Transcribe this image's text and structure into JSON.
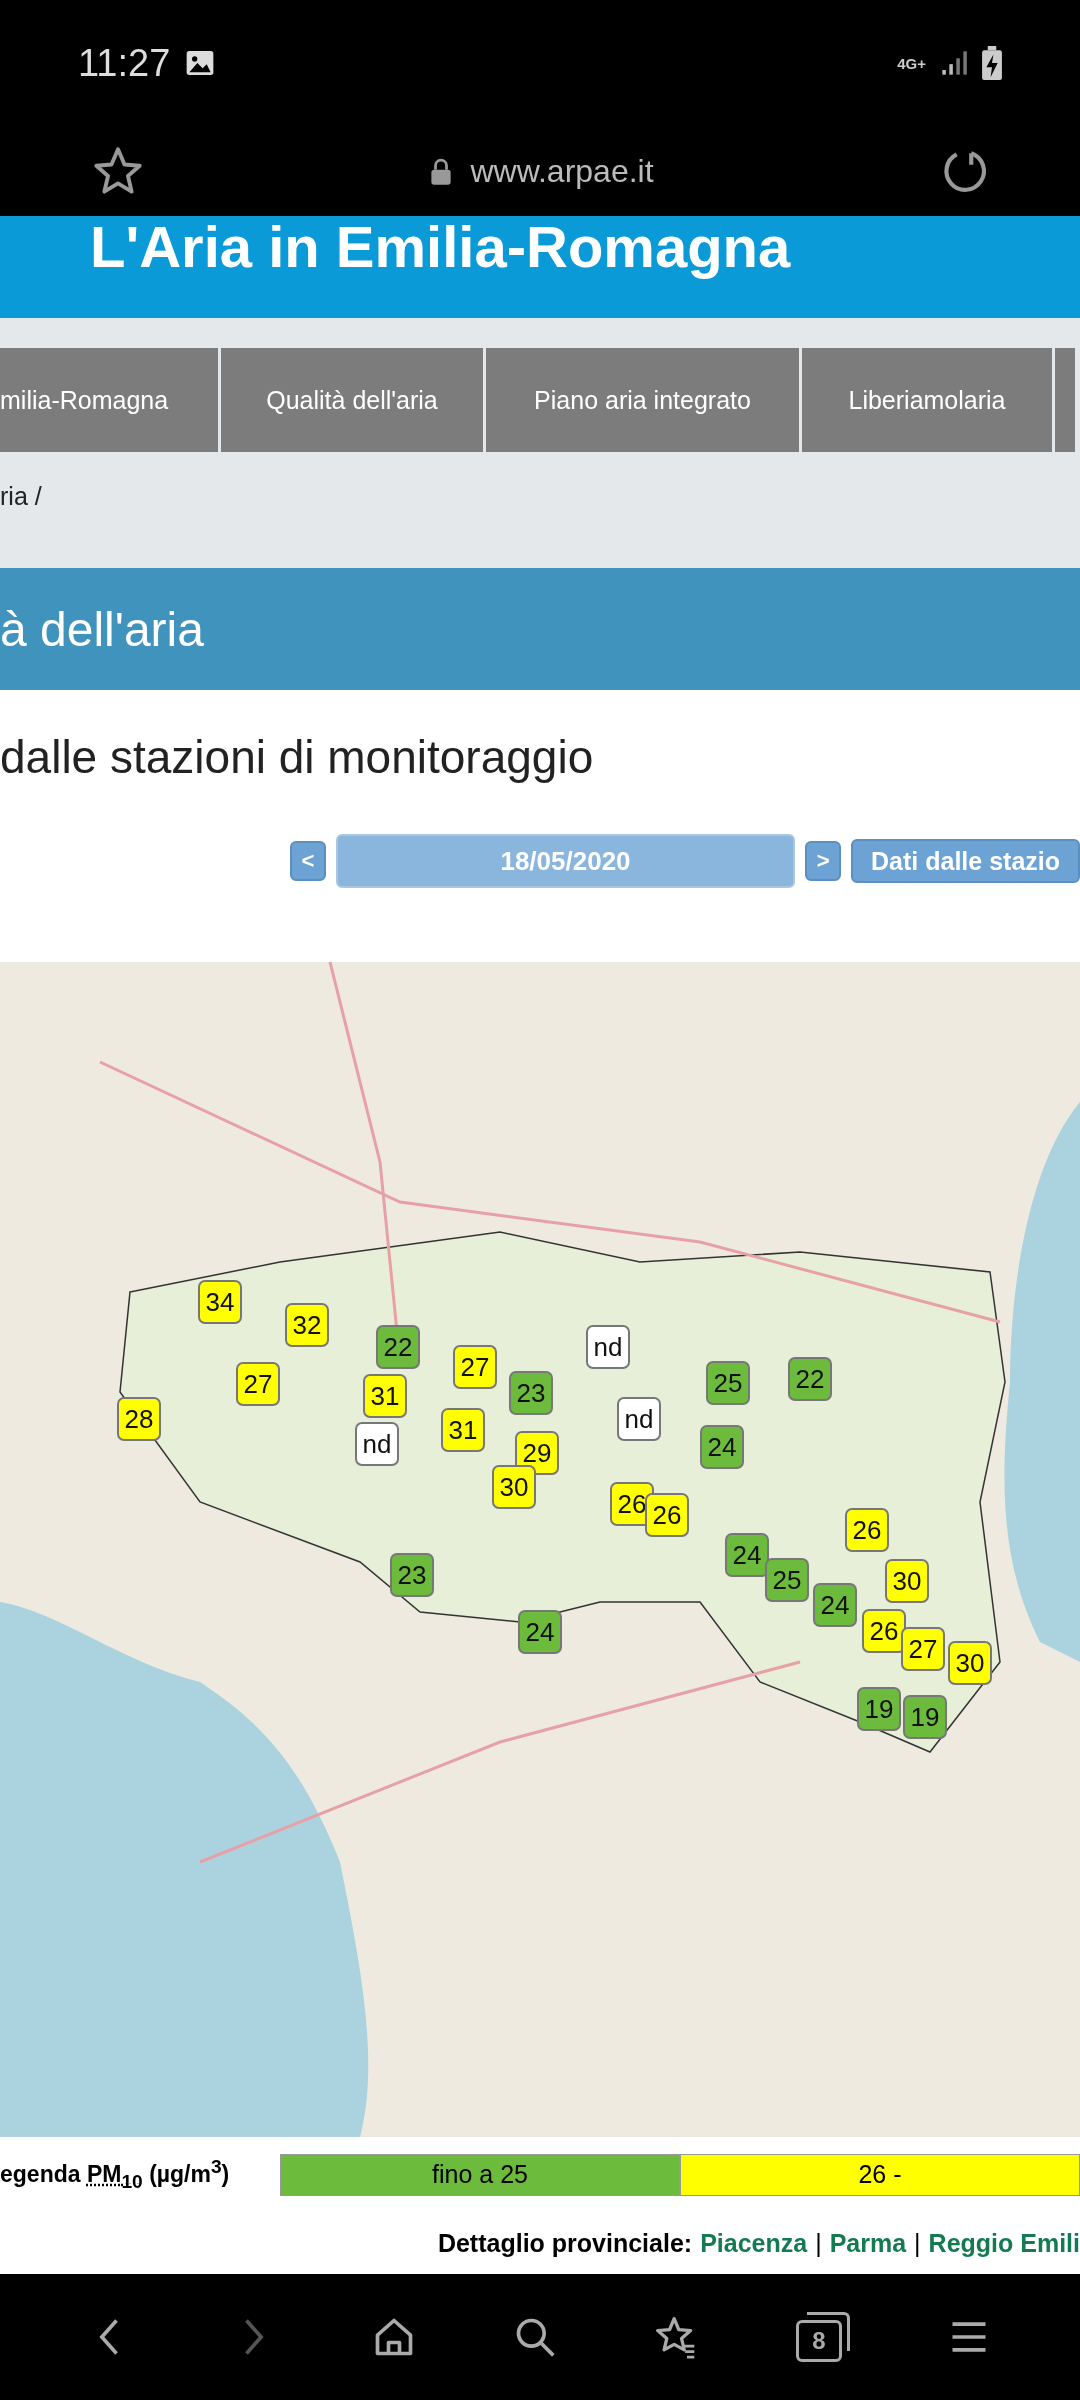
{
  "status_bar": {
    "time": "11:27",
    "network": "4G+"
  },
  "browser": {
    "url": "www.arpae.it",
    "tab_count": "8"
  },
  "banner": {
    "title": "L'Aria in Emilia-Romagna"
  },
  "nav": {
    "items": [
      "milia-Romagna",
      "Qualità dell'aria",
      "Piano aria integrato",
      "Liberiamolaria"
    ]
  },
  "breadcrumb": "ria /",
  "page_title": "à dell'aria",
  "section_title": "dalle stazioni di monitoraggio",
  "date_nav": {
    "prev": "<",
    "date": "18/05/2020",
    "next": ">",
    "stations_button": "Dati dalle stazio"
  },
  "map": {
    "markers": [
      {
        "value": "34",
        "color": "#ffff00"
      },
      {
        "value": "32",
        "color": "#ffff00"
      },
      {
        "value": "22",
        "color": "#6dbb3c"
      },
      {
        "value": "27",
        "color": "#ffff00"
      },
      {
        "value": "nd",
        "color": "#ffffff"
      },
      {
        "value": "27",
        "color": "#ffff00"
      },
      {
        "value": "31",
        "color": "#ffff00"
      },
      {
        "value": "23",
        "color": "#6dbb3c"
      },
      {
        "value": "25",
        "color": "#6dbb3c"
      },
      {
        "value": "22",
        "color": "#6dbb3c"
      },
      {
        "value": "28",
        "color": "#ffff00"
      },
      {
        "value": "31",
        "color": "#ffff00"
      },
      {
        "value": "nd",
        "color": "#ffffff"
      },
      {
        "value": "nd",
        "color": "#ffffff"
      },
      {
        "value": "29",
        "color": "#ffff00"
      },
      {
        "value": "24",
        "color": "#6dbb3c"
      },
      {
        "value": "30",
        "color": "#ffff00"
      },
      {
        "value": "26",
        "color": "#ffff00"
      },
      {
        "value": "26",
        "color": "#ffff00"
      },
      {
        "value": "26",
        "color": "#ffff00"
      },
      {
        "value": "24",
        "color": "#6dbb3c"
      },
      {
        "value": "23",
        "color": "#6dbb3c"
      },
      {
        "value": "25",
        "color": "#6dbb3c"
      },
      {
        "value": "30",
        "color": "#ffff00"
      },
      {
        "value": "24",
        "color": "#6dbb3c"
      },
      {
        "value": "24",
        "color": "#6dbb3c"
      },
      {
        "value": "26",
        "color": "#ffff00"
      },
      {
        "value": "27",
        "color": "#ffff00"
      },
      {
        "value": "30",
        "color": "#ffff00"
      },
      {
        "value": "19",
        "color": "#6dbb3c"
      },
      {
        "value": "19",
        "color": "#6dbb3c"
      }
    ]
  },
  "legend": {
    "title": "egenda",
    "pollutant": "PM$_{10}$",
    "unit": "(µg/m$^{3}$)",
    "ranges": [
      {
        "label": "fino a 25",
        "color": "#6dbb3c"
      },
      {
        "label": "26 -",
        "color": "#ffff00"
      }
    ]
  },
  "provinces": {
    "label": "Dettaglio provinciale:",
    "separator": "|",
    "links": [
      "Piacenza",
      "Parma",
      "Reggio Emili"
    ]
  }
}
